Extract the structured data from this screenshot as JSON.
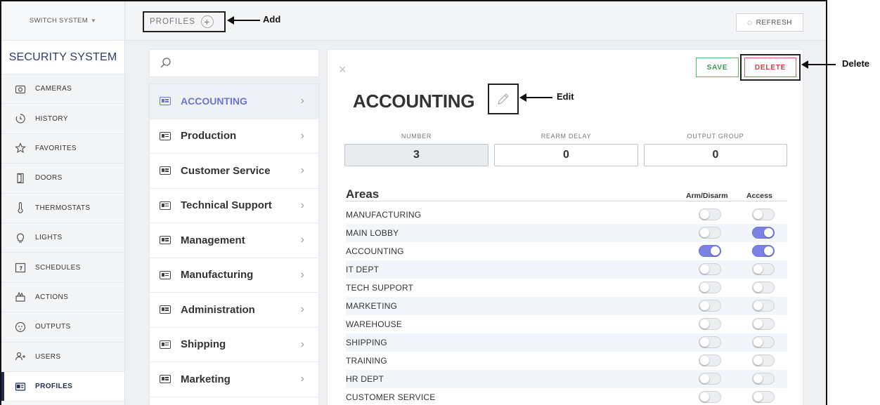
{
  "app": {
    "switch_label": "SWITCH SYSTEM",
    "switch_caret": "▼",
    "brand": "SECURITY SYSTEM"
  },
  "sidebar": {
    "items": [
      {
        "label": "CAMERAS",
        "icon": "camera-icon"
      },
      {
        "label": "HISTORY",
        "icon": "history-icon"
      },
      {
        "label": "FAVORITES",
        "icon": "star-icon"
      },
      {
        "label": "DOORS",
        "icon": "door-icon"
      },
      {
        "label": "THERMOSTATS",
        "icon": "thermometer-icon"
      },
      {
        "label": "LIGHTS",
        "icon": "bulb-icon"
      },
      {
        "label": "SCHEDULES",
        "icon": "calendar-icon"
      },
      {
        "label": "ACTIONS",
        "icon": "actions-icon"
      },
      {
        "label": "OUTPUTS",
        "icon": "outlet-icon"
      },
      {
        "label": "USERS",
        "icon": "users-icon"
      },
      {
        "label": "PROFILES",
        "icon": "profile-card-icon",
        "active": true
      }
    ]
  },
  "topbar": {
    "profiles_label": "PROFILES",
    "add_symbol": "+",
    "refresh_label": "REFRESH",
    "refresh_symbol": "◌"
  },
  "profiles_list": {
    "chevron": "›",
    "items": [
      {
        "label": "ACCOUNTING",
        "selected": true
      },
      {
        "label": "Production"
      },
      {
        "label": "Customer Service"
      },
      {
        "label": "Technical Support"
      },
      {
        "label": "Management"
      },
      {
        "label": "Manufacturing"
      },
      {
        "label": "Administration"
      },
      {
        "label": "Shipping"
      },
      {
        "label": "Marketing"
      }
    ]
  },
  "detail": {
    "close_symbol": "×",
    "save_label": "SAVE",
    "delete_label": "DELETE",
    "title": "ACCOUNTING",
    "fields": {
      "number": {
        "label": "NUMBER",
        "value": "3"
      },
      "rearm": {
        "label": "REARM DELAY",
        "value": "0"
      },
      "output": {
        "label": "OUTPUT GROUP",
        "value": "0"
      }
    },
    "areas_title": "Areas",
    "col_arm": "Arm/Disarm",
    "col_access": "Access",
    "areas": [
      {
        "name": "MANUFACTURING",
        "arm": false,
        "access": false
      },
      {
        "name": "MAIN LOBBY",
        "arm": false,
        "access": true
      },
      {
        "name": "ACCOUNTING",
        "arm": true,
        "access": true
      },
      {
        "name": "IT DEPT",
        "arm": false,
        "access": false
      },
      {
        "name": "TECH SUPPORT",
        "arm": false,
        "access": false
      },
      {
        "name": "MARKETING",
        "arm": false,
        "access": false
      },
      {
        "name": "WAREHOUSE",
        "arm": false,
        "access": false
      },
      {
        "name": "SHIPPING",
        "arm": false,
        "access": false
      },
      {
        "name": "TRAINING",
        "arm": false,
        "access": false
      },
      {
        "name": "HR DEPT",
        "arm": false,
        "access": false
      },
      {
        "name": "CUSTOMER SERVICE",
        "arm": false,
        "access": false
      }
    ],
    "toggle_on_color": "#7b82e6"
  },
  "callouts": {
    "add": "Add",
    "edit": "Edit",
    "delete": "Delete"
  }
}
